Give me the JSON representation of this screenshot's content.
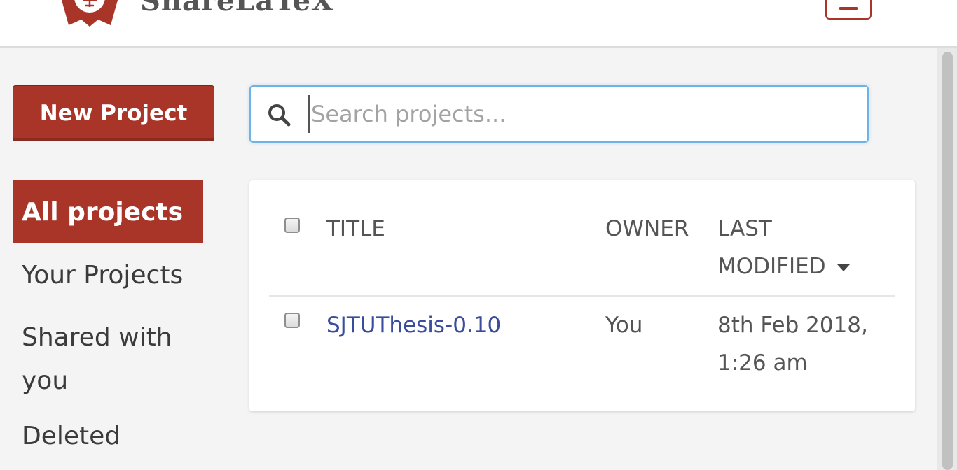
{
  "header": {
    "brand_name": "ShareLaTeX",
    "menu_icon": "menu-icon"
  },
  "sidebar": {
    "new_project_label": "New Project",
    "nav": [
      {
        "label": "All projects",
        "active": true
      },
      {
        "label": "Your Projects",
        "active": false
      },
      {
        "label": "Shared with you",
        "active": false
      },
      {
        "label": "Deleted",
        "active": false
      }
    ]
  },
  "search": {
    "placeholder": "Search projects...",
    "value": "",
    "icon": "search-icon"
  },
  "projects_table": {
    "columns": {
      "title": "TITLE",
      "owner": "OWNER",
      "last_modified": "LAST MODIFIED"
    },
    "rows": [
      {
        "title": "SJTUThesis-0.10",
        "owner": "You",
        "last_modified": "8th Feb 2018, 1:26 am",
        "checked": false
      }
    ]
  },
  "colors": {
    "accent": "#a93529",
    "link": "#3a4c9c",
    "focus_border": "#6db3e8"
  }
}
